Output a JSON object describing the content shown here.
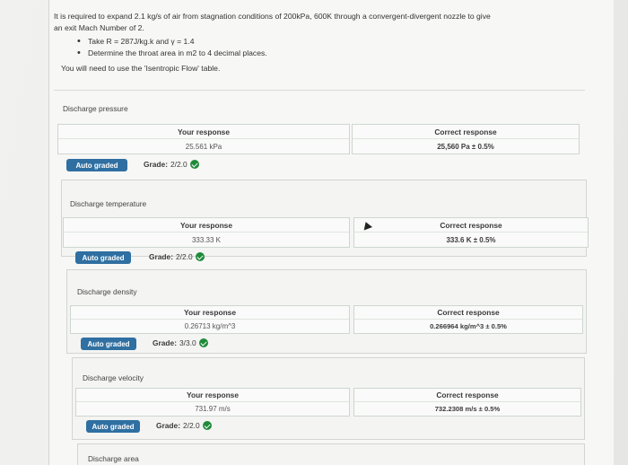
{
  "question": {
    "line1": "It is required to expand 2.1 kg/s of air from stagnation conditions of 200kPa, 600K through a convergent-divergent nozzle to give",
    "line2": "an exit Mach Number of 2.",
    "bullets": [
      "Take R = 287J/kg.k and γ = 1.4",
      "Determine the throat area in m2 to 4 decimal places."
    ],
    "note": "You will need to use the 'Isentropic Flow' table."
  },
  "labels": {
    "your_response": "Your response",
    "correct_response": "Correct response",
    "auto_graded": "Auto graded",
    "grade": "Grade:"
  },
  "sections": [
    {
      "title": "Discharge pressure",
      "your": "25.561 kPa",
      "correct": "25,560 Pa ± 0.5%",
      "grade": "2/2.0"
    },
    {
      "title": "Discharge temperature",
      "your": "333.33 K",
      "correct": "333.6 K ± 0.5%",
      "grade": "2/2.0"
    },
    {
      "title": "Discharge density",
      "your": "0.26713 kg/m^3",
      "correct": "0.266964 kg/m^3 ± 0.5%",
      "grade": "3/3.0"
    },
    {
      "title": "Discharge velocity",
      "your": "731.97 m/s",
      "correct": "732.2308 m/s ± 0.5%",
      "grade": "2/2.0"
    },
    {
      "title": "Discharge area"
    }
  ],
  "colors": {
    "badge": "#2f6fa1",
    "check": "#1f8a3a"
  },
  "icons": {
    "grade_status": "check-circle-icon",
    "pointer": "mouse-cursor-icon"
  }
}
